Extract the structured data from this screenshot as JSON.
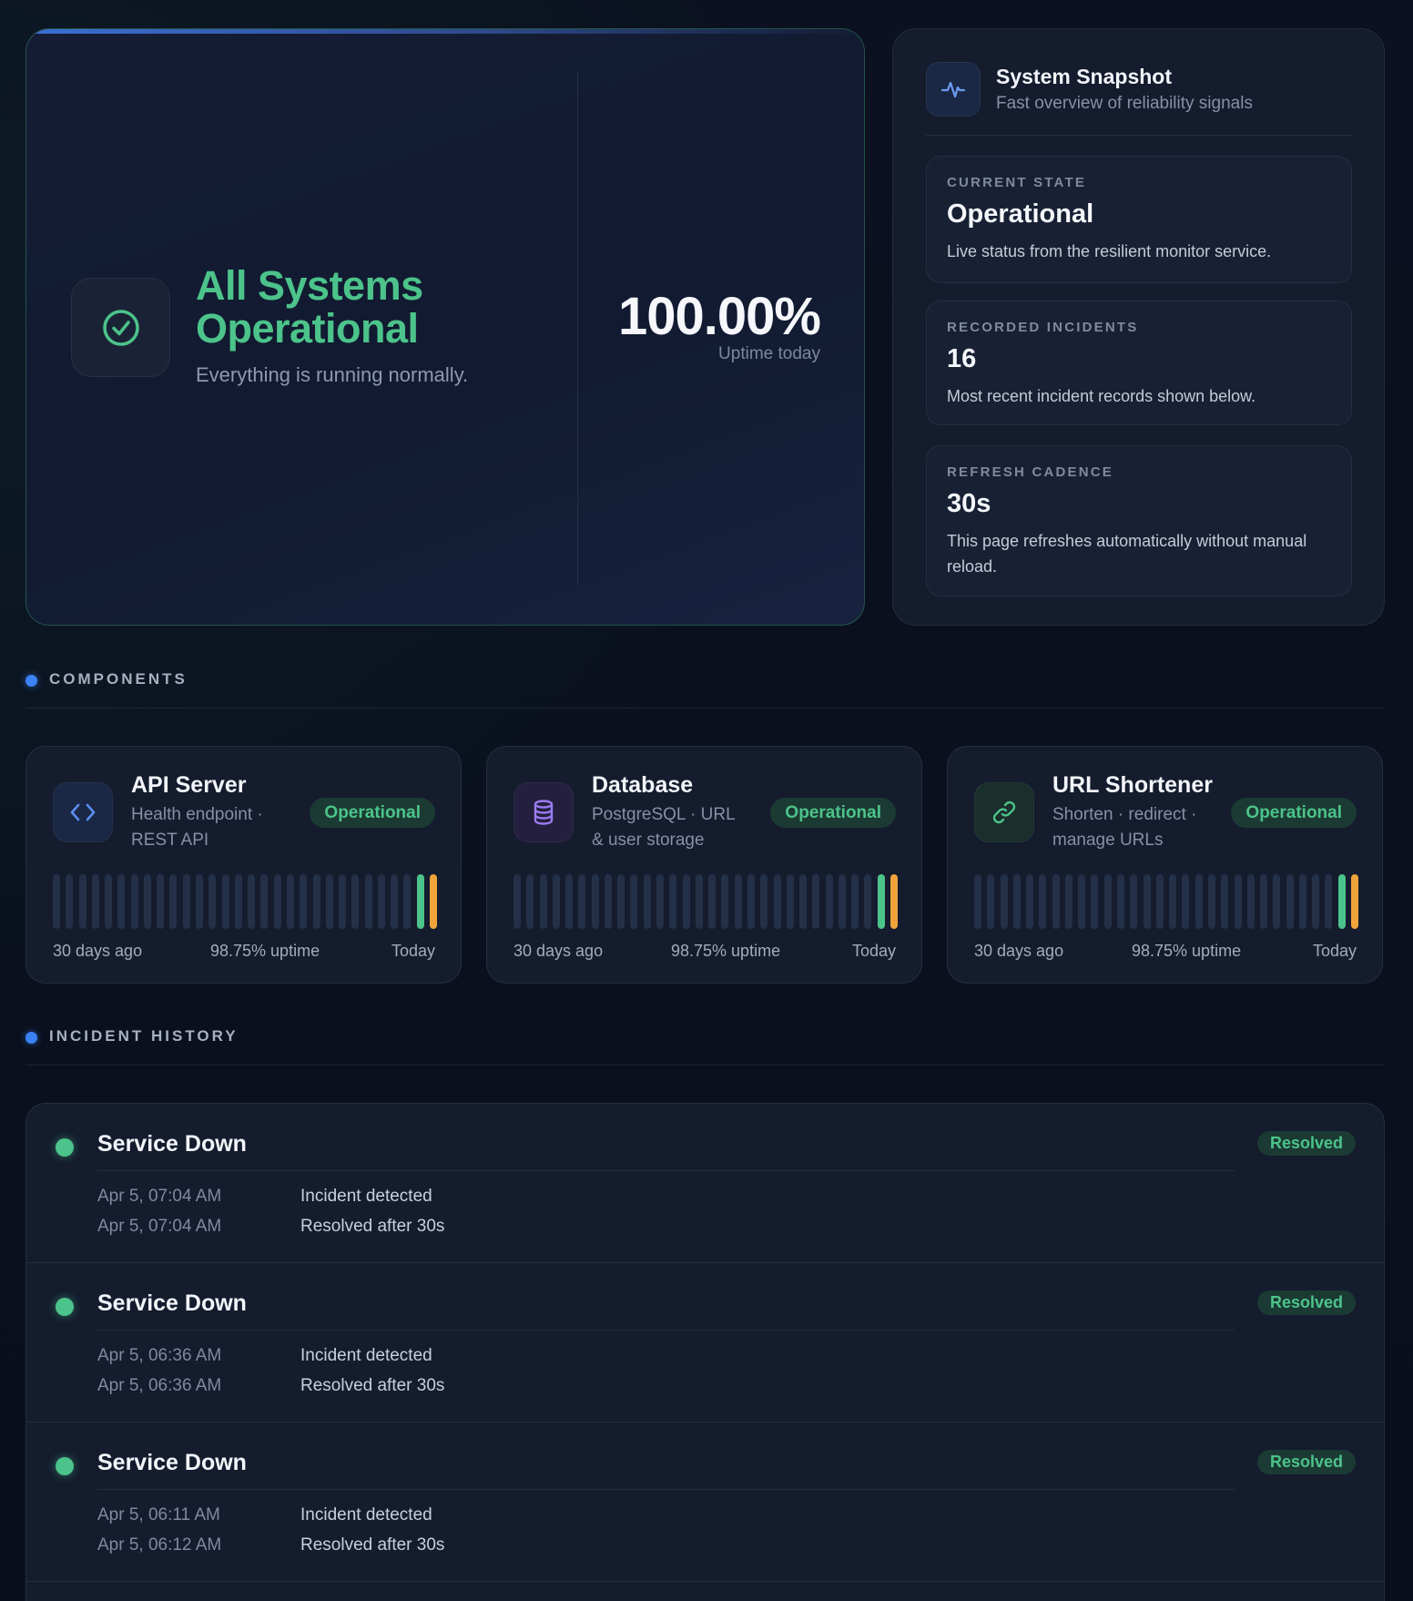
{
  "hero": {
    "title": "All Systems Operational",
    "subtitle": "Everything is running normally.",
    "uptime_value": "100.00%",
    "uptime_label": "Uptime today",
    "icon": "check-circle-icon"
  },
  "snapshot": {
    "title": "System Snapshot",
    "subtitle": "Fast overview of reliability signals",
    "icon": "activity-pulse-icon",
    "cards": [
      {
        "label": "CURRENT STATE",
        "value": "Operational",
        "desc": "Live status from the resilient monitor service."
      },
      {
        "label": "RECORDED INCIDENTS",
        "value": "16",
        "desc": "Most recent incident records shown below."
      },
      {
        "label": "REFRESH CADENCE",
        "value": "30s",
        "desc": "This page refreshes automatically without manual reload."
      }
    ]
  },
  "sections": {
    "components": "COMPONENTS",
    "incidents": "INCIDENT HISTORY"
  },
  "components": [
    {
      "name": "API Server",
      "desc": "Health endpoint · REST API",
      "status": "Operational",
      "icon": "code-brackets-icon",
      "start_label": "30 days ago",
      "uptime_label": "98.75% uptime",
      "end_label": "Today",
      "days": 30,
      "recent": [
        "operational",
        "degraded"
      ]
    },
    {
      "name": "Database",
      "desc": "PostgreSQL · URL & user storage",
      "status": "Operational",
      "icon": "database-icon",
      "start_label": "30 days ago",
      "uptime_label": "98.75% uptime",
      "end_label": "Today",
      "days": 30,
      "recent": [
        "operational",
        "degraded"
      ]
    },
    {
      "name": "URL Shortener",
      "desc": "Shorten · redirect · manage URLs",
      "status": "Operational",
      "icon": "link-icon",
      "start_label": "30 days ago",
      "uptime_label": "98.75% uptime",
      "end_label": "Today",
      "days": 30,
      "recent": [
        "operational",
        "degraded"
      ]
    }
  ],
  "incidents": [
    {
      "title": "Service Down",
      "status": "Resolved",
      "detected_time": "Apr 5, 07:04 AM",
      "detected_text": "Incident detected",
      "resolved_time": "Apr 5, 07:04 AM",
      "resolved_text": "Resolved after 30s"
    },
    {
      "title": "Service Down",
      "status": "Resolved",
      "detected_time": "Apr 5, 06:36 AM",
      "detected_text": "Incident detected",
      "resolved_time": "Apr 5, 06:36 AM",
      "resolved_text": "Resolved after 30s"
    },
    {
      "title": "Service Down",
      "status": "Resolved",
      "detected_time": "Apr 5, 06:11 AM",
      "detected_text": "Incident detected",
      "resolved_time": "Apr 5, 06:12 AM",
      "resolved_text": "Resolved after 30s"
    }
  ],
  "colors": {
    "operational": "#4cc38a",
    "degraded": "#f0a33a",
    "empty": "#243047",
    "accent": "#3b82f6"
  }
}
